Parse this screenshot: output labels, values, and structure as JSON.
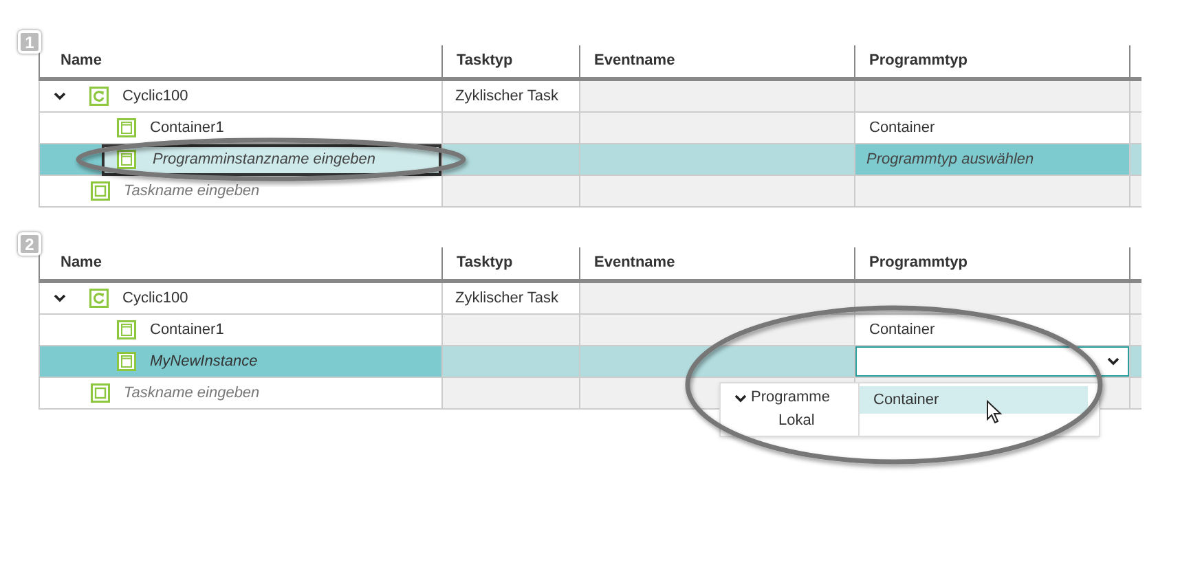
{
  "panels": [
    {
      "badge": "1",
      "columns": [
        "Name",
        "Tasktyp",
        "Eventname",
        "Programmtyp"
      ],
      "rows": [
        {
          "kind": "task",
          "name": "Cyclic100",
          "expanded": true,
          "tasktyp": "Zyklischer Task",
          "selected": false
        },
        {
          "kind": "program",
          "name": "Container1",
          "programmtyp": "Container",
          "selected": false
        },
        {
          "kind": "program_edit",
          "placeholder": "Programminstanzname eingeben",
          "programmtyp_placeholder": "Programmtyp auswählen",
          "selected": true
        },
        {
          "kind": "new_task",
          "name": "Taskname eingeben",
          "selected": false
        }
      ]
    },
    {
      "badge": "2",
      "columns": [
        "Name",
        "Tasktyp",
        "Eventname",
        "Programmtyp"
      ],
      "rows": [
        {
          "kind": "task",
          "name": "Cyclic100",
          "expanded": true,
          "tasktyp": "Zyklischer Task",
          "selected": false
        },
        {
          "kind": "program",
          "name": "Container1",
          "programmtyp": "Container",
          "selected": false
        },
        {
          "kind": "program_new",
          "name": "MyNewInstance",
          "programmtyp_select": true,
          "selected": true
        },
        {
          "kind": "new_task",
          "name": "Taskname eingeben",
          "selected": false
        }
      ],
      "dropdown": {
        "categories": [
          {
            "label": "Programme",
            "expanded": true,
            "children": [
              {
                "label": "Lokal"
              }
            ]
          }
        ],
        "options": [
          {
            "label": "Container",
            "selected": true
          }
        ]
      }
    }
  ]
}
